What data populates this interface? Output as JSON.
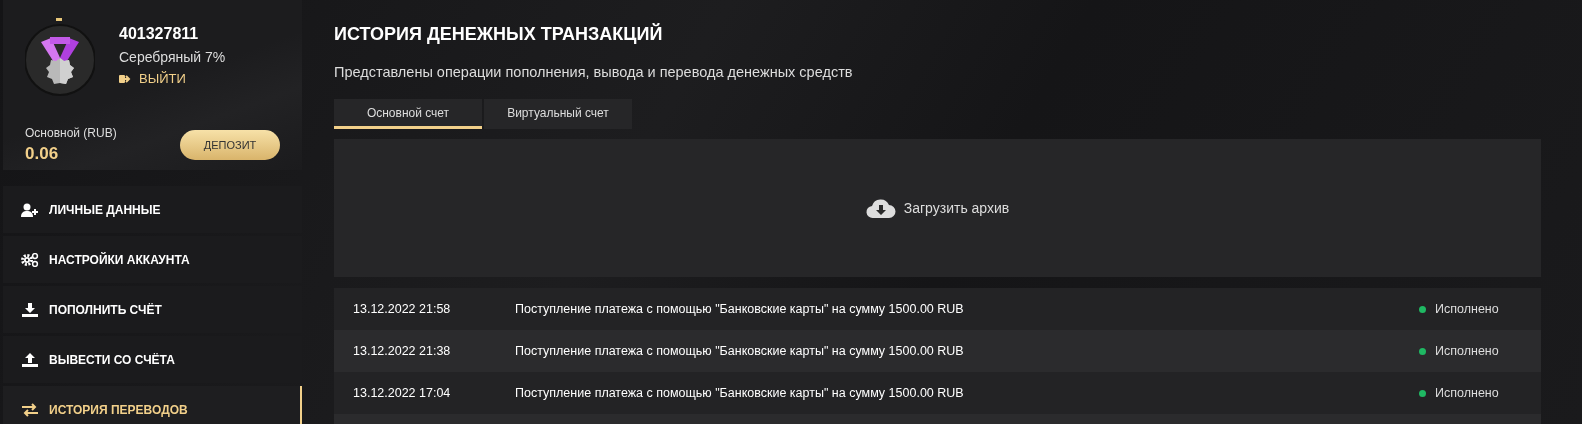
{
  "profile": {
    "account_id": "401327811",
    "level": "Серебряный 7%",
    "logout": "ВЫЙТИ",
    "balance_label": "Основной (RUB)",
    "balance": "0.06",
    "deposit_button": "ДЕПОЗИТ"
  },
  "menu": [
    {
      "kind": "user",
      "label": "ЛИЧНЫЕ ДАННЫЕ",
      "selected": false
    },
    {
      "kind": "gears",
      "label": "НАСТРОЙКИ АККАУНТА",
      "selected": false
    },
    {
      "kind": "download",
      "label": "ПОПОЛНИТЬ СЧЁТ",
      "selected": false
    },
    {
      "kind": "upload",
      "label": "ВЫВЕСТИ СО СЧЁТА",
      "selected": false
    },
    {
      "kind": "transfer",
      "label": "ИСТОРИЯ ПЕРЕВОДОВ",
      "selected": true
    }
  ],
  "page": {
    "title": "ИСТОРИЯ ДЕНЕЖНЫХ ТРАНЗАКЦИЙ",
    "subtitle": "Представлены операции пополнения, вывода и перевода денежных средств"
  },
  "tabs": [
    {
      "label": "Основной счет",
      "selected": true
    },
    {
      "label": "Виртуальный счет",
      "selected": false
    }
  ],
  "archive_button": "Загрузить архив",
  "transactions": [
    {
      "date": "13.12.2022 21:58",
      "description": "Поступление платежа с помощью \"Банковские карты\" на сумму 1500.00 RUB",
      "status": "Исполнено",
      "color": "#1fb863"
    },
    {
      "date": "13.12.2022 21:38",
      "description": "Поступление платежа с помощью \"Банковские карты\" на сумму 1500.00 RUB",
      "status": "Исполнено",
      "color": "#1fb863"
    },
    {
      "date": "13.12.2022 17:04",
      "description": "Поступление платежа с помощью \"Банковские карты\" на сумму 1500.00 RUB",
      "status": "Исполнено",
      "color": "#1fb863"
    }
  ]
}
